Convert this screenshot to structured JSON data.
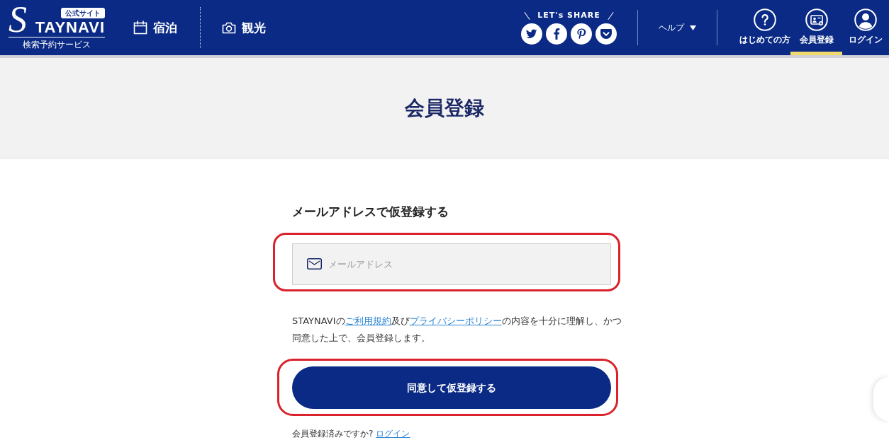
{
  "header": {
    "logo": {
      "badge": "公式サイト",
      "letter": "S",
      "wordmark": "TAYNAVI",
      "tagline": "検索予約サービス"
    },
    "nav": [
      {
        "kind": "calendar",
        "label": "宿泊"
      },
      {
        "kind": "camera",
        "label": "観光"
      }
    ],
    "share": {
      "label": "LET's SHARE",
      "buttons": [
        {
          "kind": "bird"
        },
        {
          "kind": "f"
        },
        {
          "kind": "p"
        },
        {
          "kind": "pocket"
        }
      ]
    },
    "help": {
      "label": "ヘルプ"
    },
    "menu": [
      {
        "kind": "question",
        "label": "はじめての方",
        "selected": false
      },
      {
        "kind": "card",
        "label": "会員登録",
        "selected": true
      },
      {
        "kind": "user",
        "label": "ログイン",
        "selected": false
      }
    ]
  },
  "page_title": "会員登録",
  "form": {
    "heading": "メールアドレスで仮登録する",
    "email": {
      "placeholder": "メールアドレス",
      "highlighted": true
    },
    "consent": [
      {
        "kind": "text",
        "text": "STAYNAVIの"
      },
      {
        "kind": "link",
        "text": "ご利用規約"
      },
      {
        "kind": "text",
        "text": "及び"
      },
      {
        "kind": "link",
        "text": "プライバシーポリシー"
      },
      {
        "kind": "text",
        "text": "の内容を十分に理解し、かつ同意した上で、会員登録します。"
      }
    ],
    "submit": {
      "label": "同意して仮登録する",
      "highlighted": true
    },
    "login_prompt": {
      "text": "会員登録済みですか?",
      "link": "ログイン"
    }
  }
}
